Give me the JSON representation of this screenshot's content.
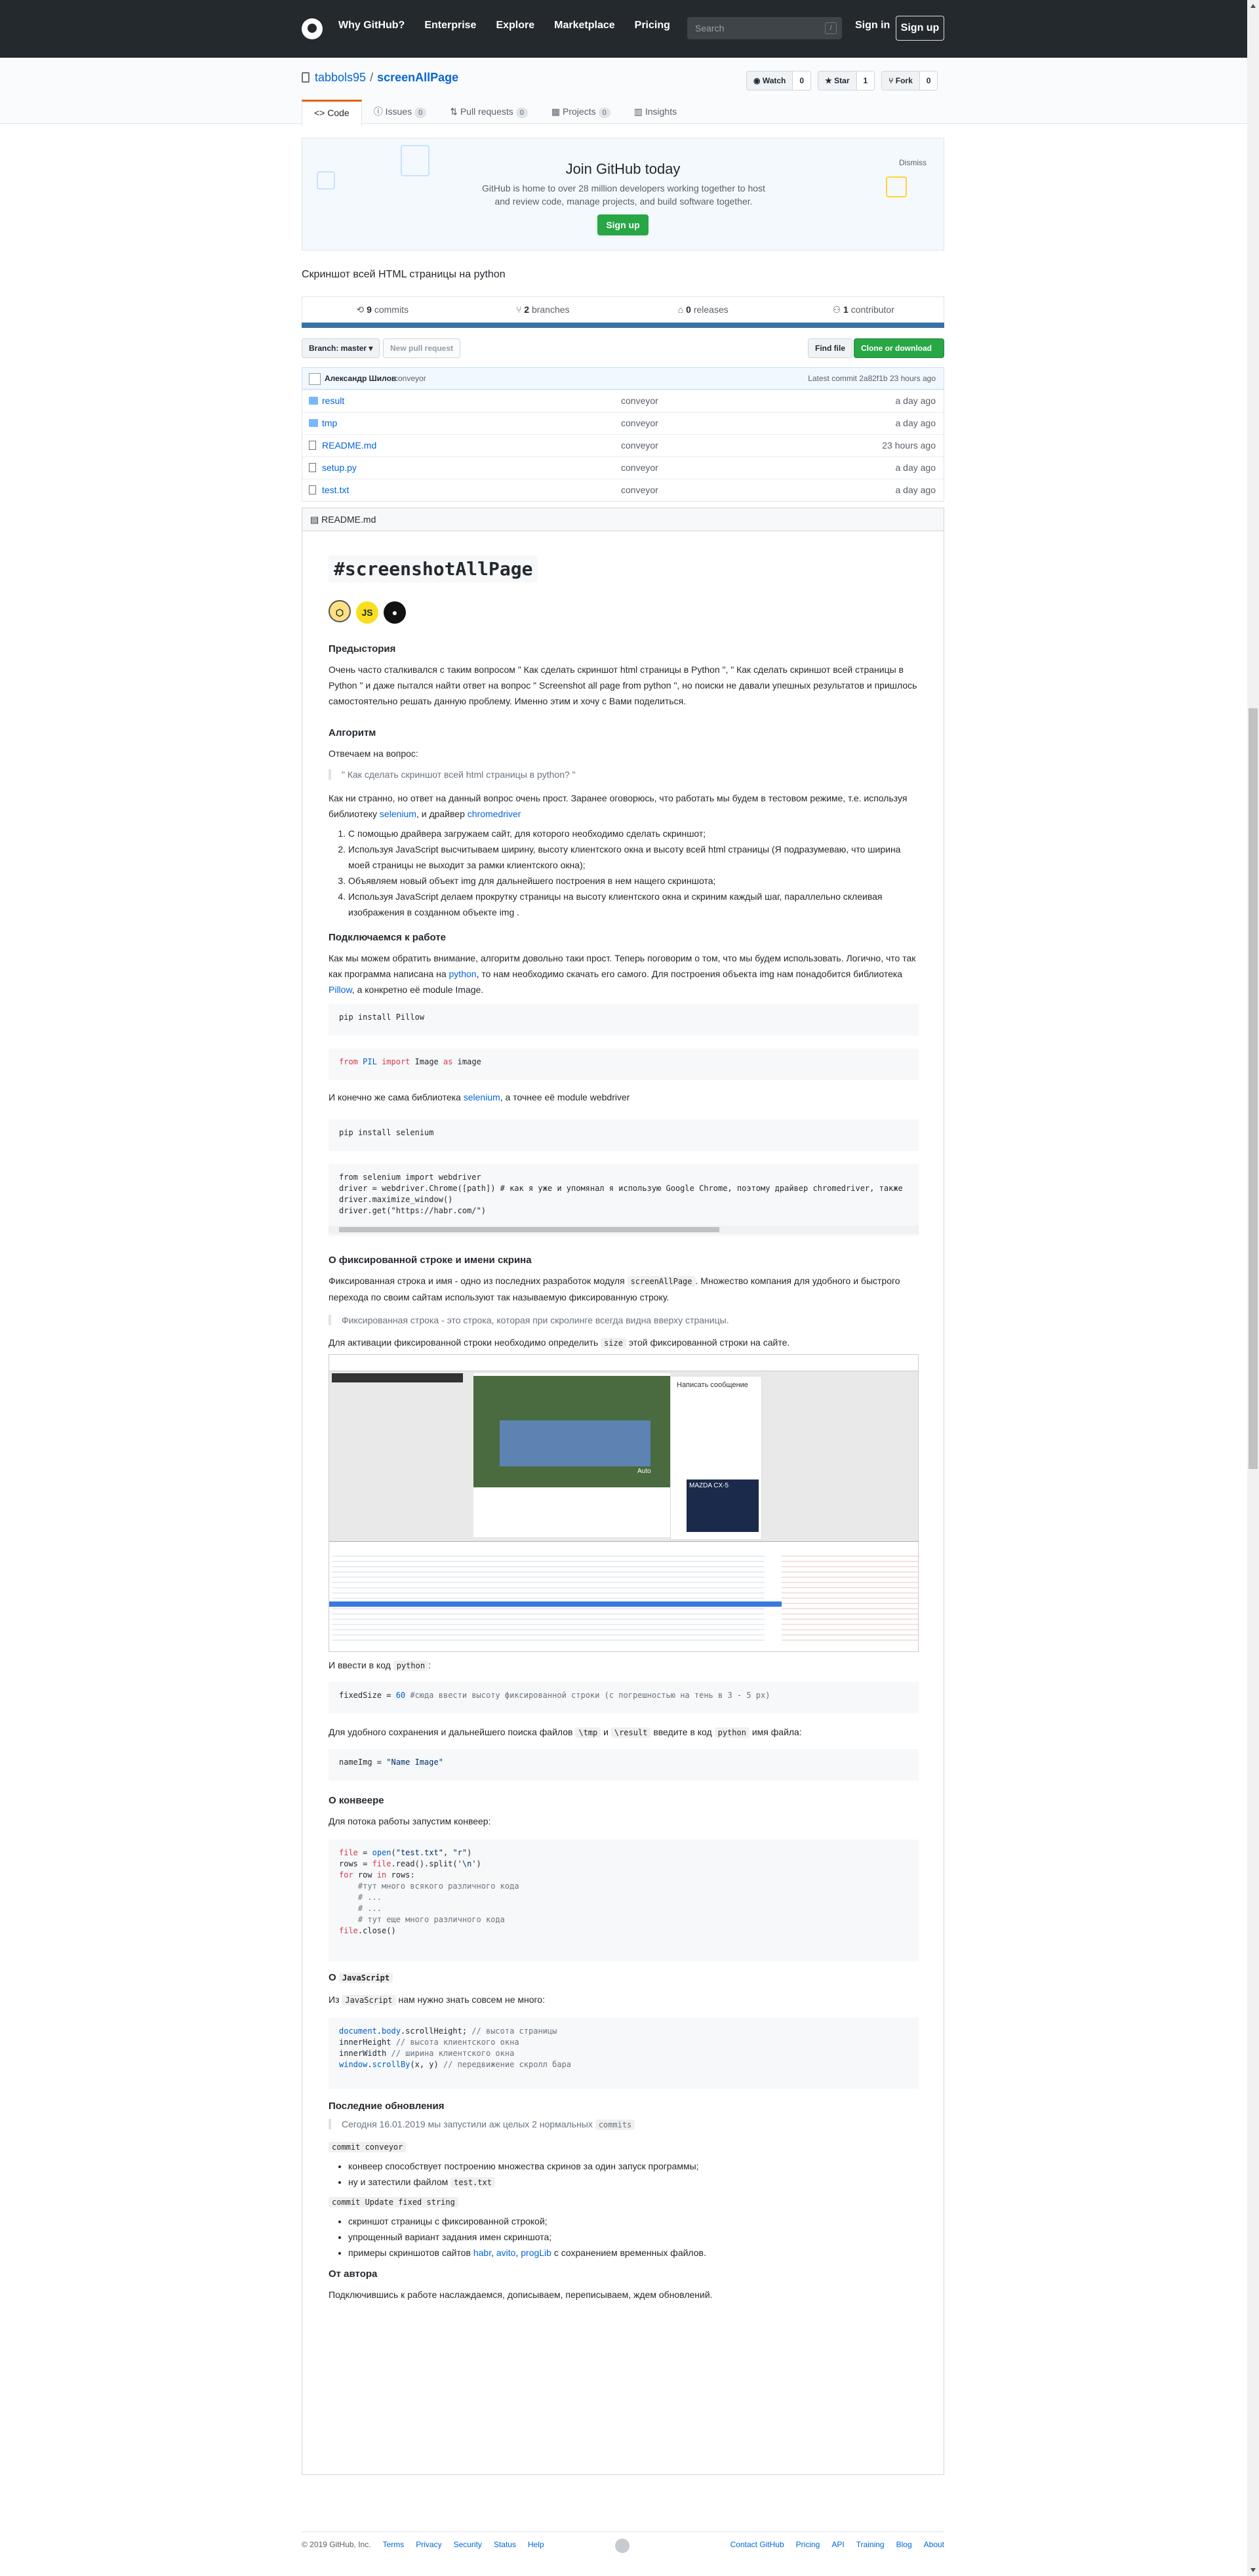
{
  "header": {
    "nav": [
      "Why GitHub?",
      "Enterprise",
      "Explore",
      "Marketplace",
      "Pricing"
    ],
    "search_placeholder": "Search",
    "search_shortcut": "/",
    "signin": "Sign in",
    "signup": "Sign up"
  },
  "repo": {
    "owner": "tabbols95",
    "name": "screenAllPage",
    "watch": {
      "label": "Watch",
      "count": "0"
    },
    "star": {
      "label": "Star",
      "count": "1"
    },
    "fork": {
      "label": "Fork",
      "count": "0"
    },
    "tabs": [
      {
        "label": "Code",
        "count": ""
      },
      {
        "label": "Issues",
        "count": "0"
      },
      {
        "label": "Pull requests",
        "count": "0"
      },
      {
        "label": "Projects",
        "count": "0"
      },
      {
        "label": "Insights",
        "count": ""
      }
    ]
  },
  "banner": {
    "title": "Join GitHub today",
    "text": "GitHub is home to over 28 million developers working together to host and review code, manage projects, and build software together.",
    "button": "Sign up",
    "dismiss": "Dismiss"
  },
  "description": "Скриншот всей HTML страницы на python",
  "summary": {
    "commits_n": "9",
    "commits": "commits",
    "branches_n": "2",
    "branches": "branches",
    "releases_n": "0",
    "releases": "releases",
    "contributors_n": "1",
    "contributors": "contributor"
  },
  "branch": {
    "label": "Branch: master ▾",
    "new_pr": "New pull request",
    "find": "Find file",
    "clone": "Clone or download ▾"
  },
  "commit": {
    "author": "Александр Шилов",
    "message": "conveyor",
    "latest": "Latest commit 2a82f1b 23 hours ago"
  },
  "files": [
    {
      "name": "result",
      "type": "folder",
      "msg": "conveyor",
      "time": "a day ago"
    },
    {
      "name": "tmp",
      "type": "folder",
      "msg": "conveyor",
      "time": "a day ago"
    },
    {
      "name": "README.md",
      "type": "file",
      "msg": "conveyor",
      "time": "23 hours ago"
    },
    {
      "name": "setup.py",
      "type": "file",
      "msg": "conveyor",
      "time": "a day ago"
    },
    {
      "name": "test.txt",
      "type": "file",
      "msg": "conveyor",
      "time": "a day ago"
    }
  ],
  "readme": {
    "file": "README.md",
    "title": "#screenshotAllPage",
    "badges": [
      "JS"
    ],
    "h_pre": "Предыстория",
    "p_pre": "Очень часто сталкивался с таким вопросом \" Как сделать скриншот html страницы в Python \", \" Как сделать скриншот всей страницы в Python \" и даже пытался найти ответ на вопрос \" Screenshot all page from python \", но поиски не давали упешных результатов и пришлось самостоятельно решать данную проблему. Именно этим и хочу с Вами поделиться.",
    "h_algo": "Алгоритм",
    "p_answer": "Отвечаем на вопрос:",
    "q1": "\" Как сделать скриншот всей html страницы в python? \"",
    "p_strange_a": "Как ни странно, но ответ на данный вопрос очень прост. Заранее оговорюсь, что работать мы будем в тестовом режиме, т.е. используя библиотеку",
    "link_selenium": "selenium",
    "p_strange_b": ", и драйвер",
    "link_chromedriver": "chromedriver",
    "steps": [
      "С помощью драйвера загружаем сайт, для которого необходимо сделать скриншот;",
      "Используя JavaScript высчитываем ширину, высоту клиентского окна и высоту всей html страницы (Я подразумеваю, что ширина моей страницы не выходит за рамки клиентского окна);",
      "Объявляем новый объект img для дальнейшего построения в нем нащего скриншота;",
      "Используя JavaScript делаем прокрутку страницы на высоту клиентского окна и скриним каждый шаг, параллельно склеивая изображения в созданном объекте img ."
    ],
    "h_connect": "Подключаемся к работе",
    "p_connect_a": "Как мы можем обратить внимание, алгоритм довольно таки прост. Теперь поговорим о том, что мы будем использовать. Логично, что так как программа написана на",
    "link_python": "python",
    "p_connect_b": ", то нам необходимо скачать его самого. Для построения объекта img нам понадобится библиотека",
    "link_pillow": "Pillow",
    "p_connect_c": ", а конкретно её module Image.",
    "code_pip_pillow": "pip install Pillow",
    "code_import": "from PIL import Image as image",
    "p_selenium_a": "И конечно же сама библиотека",
    "p_selenium_b": ", а точнее её module webdriver",
    "code_pip_selenium": "pip install selenium",
    "code_webdriver": "from selenium import webdriver\ndriver = webdriver.Chrome([path]) # как я уже и упомянал я использую Google Chrome, поэтому драйвер chromedriver, также\ndriver.maximize_window()\ndriver.get(\"https://habr.com/\")",
    "h_fixed": "О фиксированной строке и имени скрина",
    "p_fixed_a": "Фиксированная строка и имя - одно из последних разработок модуля",
    "p_fixed_code": "screenAllPage",
    "p_fixed_b": ". Множество компания для удобного и быстрого перехода по своим сайтам используют так называемую фиксированную строку.",
    "q2": "Фиксированная строка - это строка, которая при скролинге всегда видна вверху страницы.",
    "p_activate_a": "Для активации фиксированной строки необходимо определить",
    "p_activate_code": "size",
    "p_activate_b": "этой фиксированной строки на сайте.",
    "shot_texts": [
      "Написать сообщение",
      "MAZDA CX-5",
      "Auto"
    ],
    "p_enter": "И ввести в код",
    "p_enter_code": "python",
    "code_fixed": "fixedSize = 60 #сюда ввести высоту фиксированной строки (с погрешностью на тень в 3 - 5 px)",
    "p_save_a": "Для удобного сохранения и дальнейшего поиска файлов",
    "p_save_c1": "\\tmp",
    "p_save_and": "и",
    "p_save_c2": "\\result",
    "p_save_b": "введите в код",
    "p_save_c3": "python",
    "p_save_c": "имя файла:",
    "code_name": "nameImg = \"Name Image\"",
    "h_conv": "О конвеере",
    "p_conv": "Для потока работы запустим конвеер:",
    "code_conv": "file = open(\"test.txt\", \"r\")\nrows = file.read().split('\\n')\nfor row in rows:\n    #тут много всякого различного кода\n    # ...\n    # ...\n    # тут еще много различного кода\nfile.close()",
    "h_js_pre": "О",
    "h_js_code": "JavaScript",
    "p_js_a": "Из",
    "p_js_code": "JavaScript",
    "p_js_b": "нам нужно знать совсем не много:",
    "code_js": "document.body.scrollHeight; // высота страницы\ninnerHeight // высота клиентского окна\ninnerWidth // ширина клиентского окна\nwindow.scrollBy(x, y) // передвижение скролл бара",
    "h_updates": "Последние обновления",
    "q3_a": "Сегодня 16.01.2019 мы запустили аж целых 2 нормальных",
    "q3_code": "commits",
    "c1": "commit conveyor",
    "c1_items": [
      "конвеер способствует построению множества скринов за один запуск программы;",
      "ну и затестили файлом"
    ],
    "c1_code": "test.txt",
    "c2": "commit Update fixed string",
    "c2_items": [
      "скриншот страницы с фиксированной строкой;",
      "упрощенный вариант задания имен скриншота;"
    ],
    "c2_last_a": "примеры скриншотов сайтов",
    "c2_links": [
      "habr",
      "avito",
      "progLib"
    ],
    "c2_last_b": "с сохранением временных файлов.",
    "h_author": "От автора",
    "p_author": "Подключившись к работе наслаждаемся, дописываем, переписываем, ждем обновлений."
  },
  "footer": {
    "copyright": "© 2019 GitHub, Inc.",
    "left_links": [
      "Terms",
      "Privacy",
      "Security",
      "Status",
      "Help"
    ],
    "right_links": [
      "Contact GitHub",
      "Pricing",
      "API",
      "Training",
      "Blog",
      "About"
    ]
  }
}
